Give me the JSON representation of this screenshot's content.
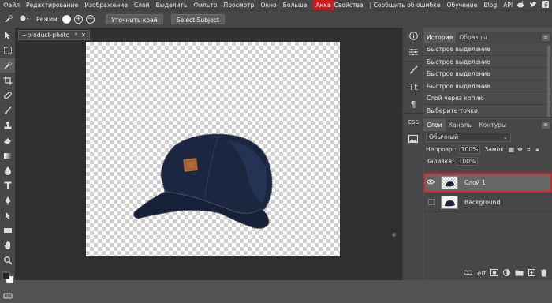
{
  "menubar": {
    "items": [
      "Файл",
      "Редактирование",
      "Изображение",
      "Слой",
      "Выделить",
      "Фильтр",
      "Просмотр",
      "Окно",
      "Больше"
    ],
    "brand": "Акка",
    "right_items": [
      "Свойства",
      "Сообщить об ошибке",
      "Обучение",
      "Blog",
      "API"
    ],
    "icons": [
      "reddit-icon",
      "twitter-icon",
      "facebook-icon"
    ]
  },
  "options": {
    "mode_label": "Режим:",
    "refine_edge_label": "Уточнить край",
    "select_subject_label": "Select Subject",
    "plus_glyph": "+",
    "minus_glyph": "−"
  },
  "document": {
    "tab_title": "~product-photo",
    "tab_marker": "*",
    "close_glyph": "✕"
  },
  "strip": {
    "text_label": "Tt",
    "css_label": "CSS"
  },
  "history": {
    "tabs": [
      "История",
      "Образцы"
    ],
    "rows": [
      "Быстрое выделение",
      "Быстрое выделение",
      "Быстрое выделение",
      "Быстрое выделение",
      "Слой через копию",
      "Выберите точки"
    ]
  },
  "layers": {
    "tabs": [
      "Слои",
      "Каналы",
      "Контуры"
    ],
    "blend_mode": "Обычный",
    "opacity_label": "Непрозр.:",
    "opacity_value": "100%",
    "lock_label": "Замок:",
    "fill_label": "Заливка:",
    "fill_value": "100%",
    "items": [
      {
        "name": "Слой 1",
        "selected": true,
        "visible": true
      },
      {
        "name": "Background",
        "selected": false,
        "visible": false
      }
    ],
    "bottom_icons": [
      "link-icon",
      "effects-icon",
      "mask-icon",
      "adjustment-icon",
      "folder-icon",
      "new-layer-icon",
      "delete-icon"
    ],
    "effects_label": "eff"
  },
  "colors": {
    "accent": "#d2191c",
    "cap": "#1b2740",
    "patch": "#b06a3a",
    "selected_outline": "#d8202a"
  }
}
